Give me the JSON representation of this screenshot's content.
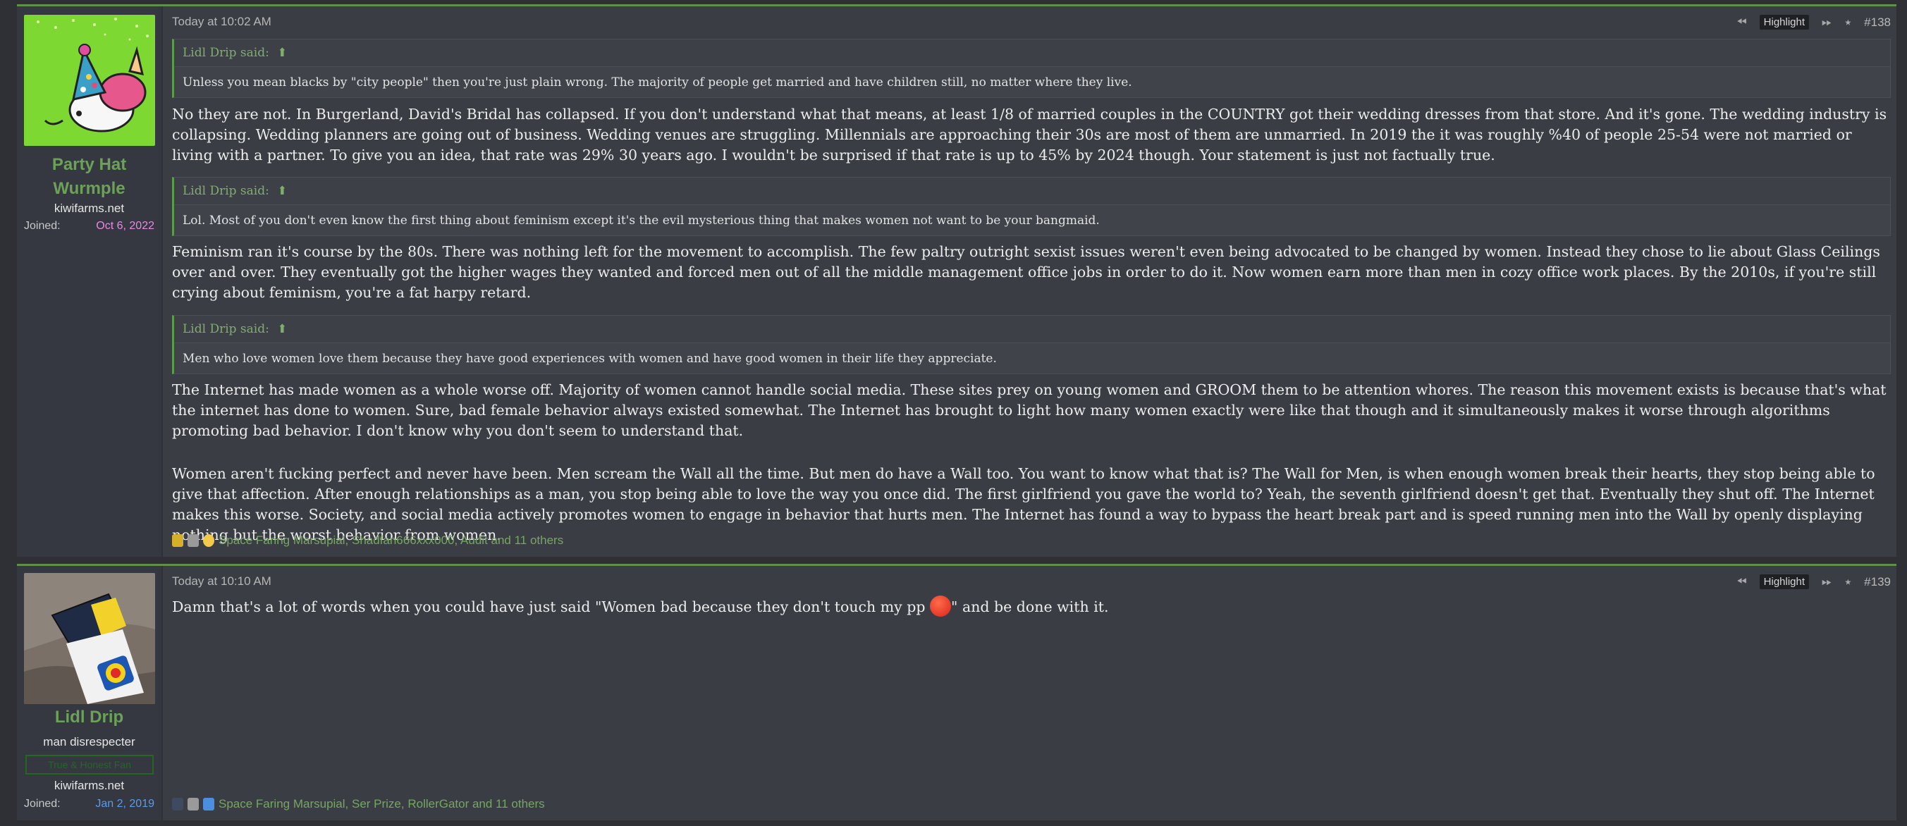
{
  "posts": [
    {
      "number": "#138",
      "timestamp": "Today at 10:02 AM",
      "highlight_label": "Highlight",
      "user": {
        "name_line1": "Party Hat",
        "name_line2": "Wurmple",
        "site": "kiwifarms.net",
        "joined_label": "Joined:",
        "joined_date": "Oct 6, 2022"
      },
      "quotes": [
        {
          "author": "Lidl Drip said:",
          "text": "Unless you mean blacks by \"city people\" then you're just plain wrong. The majority of people get married and have children still, no matter where they live."
        },
        {
          "author": "Lidl Drip said:",
          "text": "Lol. Most of you don't even know the first thing about feminism except it's the evil mysterious thing that makes women not want to be your bangmaid."
        },
        {
          "author": "Lidl Drip said:",
          "text": "Men who love women love them because they have good experiences with women and have good women in their life they appreciate."
        }
      ],
      "paragraphs": [
        "No they are not. In Burgerland, David's Bridal has collapsed. If you don't understand what that means, at least 1/8 of married couples in the COUNTRY got their wedding dresses from that store. And it's gone. The wedding industry is collapsing. Wedding planners are going out of business. Wedding venues are struggling. Millennials are approaching their 30s are most of them are unmarried. In 2019 the it was roughly %40 of people 25-54 were not married or living with a partner. To give you an idea, that rate was 29% 30 years ago. I wouldn't be surprised if that rate is up to 45% by 2024 though. Your statement is just not factually true.",
        "Feminism ran it's course by the 80s. There was nothing left for the movement to accomplish. The few paltry outright sexist issues weren't even being advocated to be changed by women. Instead they chose to lie about Glass Ceilings over and over. They eventually got the higher wages they wanted and forced men out of all the middle management office jobs in order to do it. Now women earn more than men in cozy office work places. By the 2010s, if you're still crying about feminism, you're a fat harpy retard.",
        "The Internet has made women as a whole worse off. Majority of women cannot handle social media. These sites prey on young women and GROOM them to be attention whores. The reason this movement exists is because that's what the internet has done to women. Sure, bad female behavior always existed somewhat. The Internet has brought to light how many women exactly were like that though and it simultaneously makes it worse through algorithms promoting bad behavior. I don't know why you don't seem to understand that.",
        "Women aren't fucking perfect and never have been. Men scream the Wall all the time. But men do have a Wall too. You want to know what that is? The Wall for Men, is when enough women break their hearts, they stop being able to give that affection. After enough relationships as a man, you stop being able to love the way you once did. The first girlfriend you gave the world to? Yeah, the seventh girlfriend doesn't get that. Eventually they shut off. The Internet makes this worse. Society, and social media actively promotes women to engage in behavior that hurts men. The Internet has found a way to bypass the heart break part and is speed running men into the Wall by openly displaying nothing but the worst behavior from women."
      ],
      "reactions": "Space Faring Marsupial, Shadfan666xxx000, Audit and 11 others"
    },
    {
      "number": "#139",
      "timestamp": "Today at 10:10 AM",
      "highlight_label": "Highlight",
      "user": {
        "name": "Lidl Drip",
        "title": "man disrespecter",
        "banner": "True & Honest Fan",
        "site": "kiwifarms.net",
        "joined_label": "Joined:",
        "joined_date": "Jan 2, 2019"
      },
      "body_before": "Damn that's a lot of words when you could have just said \"Women bad because they don't touch my pp ",
      "body_after": "\" and be done with it.",
      "reactions": "Space Faring Marsupial, Ser Prize, RollerGator and 11 others"
    }
  ],
  "colors": {
    "accent_green": "#5f8f48",
    "username_green": "#6ca158",
    "joined_date_pink": "#e58be0",
    "joined_date_blue": "#5c9be8"
  }
}
